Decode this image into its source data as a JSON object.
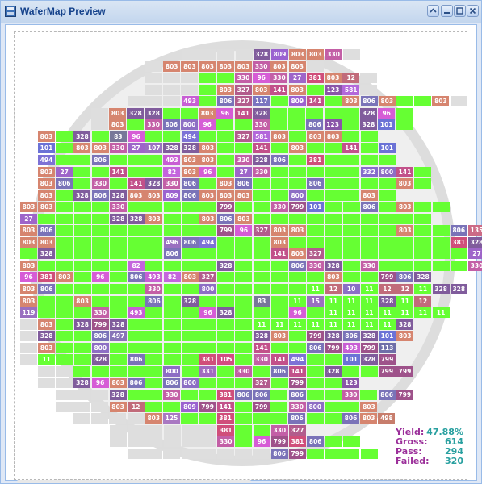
{
  "window": {
    "title": "WaferMap Preview"
  },
  "colors": {
    "pass": "#66ff33",
    "empty": "#dedede",
    "wafer_ring": "#dddddd",
    "wafer_fill": "#eeeeee",
    "bin_colors": {
      "803": "#d6856f",
      "328": "#805c9c",
      "330": "#c35fa6",
      "806": "#7a73b8",
      "141": "#c2518a",
      "96": "#d65cd6",
      "494": "#7d72d6",
      "27": "#9e65c9",
      "799": "#9e528a",
      "101": "#6b72d6",
      "381": "#d04e7a",
      "82": "#c465dd",
      "493": "#c85ed4",
      "581": "#b368db",
      "123": "#8a55a8",
      "809": "#9b62d0",
      "117": "#7a75c0",
      "12": "#c16b7a",
      "83": "#777799",
      "800": "#8d6ec4",
      "807": "#8c71b3",
      "327": "#b25c8c",
      "497": "#8974b8",
      "135": "#cc6b86",
      "498": "#c77d6c",
      "125": "#a978c2",
      "105": "#d24c82",
      "331": "#a16cc0",
      "10": "#8a6fc6",
      "113": "#6f6fa8",
      "332": "#866ccc",
      "11": "#66ff33"
    }
  },
  "wafer": {
    "grid_origin_row": 0,
    "rows": [
      "E:4 D:328 D:809 D:803 D:803 D:330 E:1",
      "E:1 D:803 D:803 D:803 D:803 D:803 D:330 D:803 D:803 E:1",
      "E:3 P:2 D:330 D:96 D:330 D:27 D:381 D:803 D:12 E:1",
      "E:3 P:1 D:803 D:327 D:803 D:141 D:803 P:1 D:123 D:581 E:1",
      "E:3 D:493 P:1 D:806 D:327 D:117 P:1 D:809 D:141 P:1 D:803 D:806 D:803 P:2 D:803 E:1",
      "E:1 D:803 D:328 D:328 P:2 D:803 D:96 D:141 D:328 P:5 D:328 D:96 P:1",
      "E:1 D:803 P:1 D:330 D:806 D:800 D:96 P:2 D:330 P:2 D:806 D:123 P:1 D:328 D:101 P:1",
      "D:803 P:1 D:328 P:1 D:83 D:96 P:2 D:494 P:2 D:327 D:581 D:803 P:1 D:803 D:803 P:2",
      "D:101 P:1 D:803 D:803 D:330 D:27 D:107 D:328 D:328 D:803 P:2 D:141 P:1 D:803 P:2 D:141 P:1 D:101",
      "D:494 P:2 D:806 P:3 D:493 D:803 D:803 P:1 D:330 D:328 D:806 P:1 D:381 P:4",
      "D:803 D:27 P:2 D:141 P:2 D:82 D:803 D:96 P:1 D:27 D:330 P:5 D:332 D:800 D:141 P:1",
      "D:803 D:806 P:1 D:330 P:1 D:141 D:328 D:330 D:806 P:1 D:803 D:806 P:3 D:806 P:4 D:803 P:1",
      "D:803 P:1 D:328 D:806 D:328 D:803 D:803 D:809 D:806 D:803 D:803 D:803 P:2 D:800 P:3 D:803 P:1",
      "D:803 D:803 P:3 D:330 P:5 D:799 P:2 D:330 D:799 D:101 P:2 D:806 P:1 D:803 P:2",
      "D:27 P:4 D:328 D:328 D:803 P:2 D:803 D:806 D:803 P:10",
      "D:803 D:806 P:9 D:799 D:96 D:327 D:803 D:803 P:5 D:803 P:2 D:806 D:135",
      "D:803 D:803 P:6 D:496 D:806 D:494 P:3 D:803 P:9 D:381 D:328",
      "P:1 D:328 P:6 D:806 P:5 D:141 D:803 D:327 P:8 D:27 D:381",
      "D:803 P:5 D:82 P:4 D:328 P:3 D:806 D:330 D:328 P:1 D:330 P:5 D:330",
      "D:96 D:381 D:803 P:1 D:96 P:1 D:806 D:493 D:82 D:803 D:327 P:6 D:803 P:2 D:799 D:806 D:328",
      "D:803 D:806 P:5 D:330 P:2 D:800 P:4 P:1 D:11 D:12 D:10 D:11 D:12 D:12 D:11 D:328 D:328",
      "D:803 P:2 D:803 P:3 D:806 P:1 D:328 P:3 D:83 P:1 D:11 D:15 D:11 D:11 D:11 D:328 D:11 D:12",
      "D:119 P:3 D:330 P:1 D:493 P:3 D:96 D:328 P:3 D:96 P:1 D:11 D:11 D:11 D:11 D:11 D:11 D:11",
      "E:1 D:803 P:1 D:328 D:799 D:328 P:7 D:11 D:11 D:11 D:11 D:11 D:11 D:11 D:11 D:328",
      "E:1 D:328 P:2 D:806 D:497 P:7 D:328 D:803 P:1 D:799 D:328 D:806 D:328 D:101 D:803",
      "E:1 D:803 P:2 D:800 P:8 D:141 P:2 D:806 D:799 D:493 D:799 D:113",
      "E:1 D:11 P:2 D:328 P:1 D:806 P:3 D:381 D:105 P:1 D:330 D:141 D:494 P:2 D:101 D:328 D:799",
      "E:2 P:5 D:800 P:1 D:331 P:1 D:330 P:1 D:806 D:141 P:1 D:328 P:2 D:799 D:799",
      "E:2 D:328 D:96 D:803 D:806 P:1 D:806 D:800 P:3 D:327 P:1 D:799 P:2 D:123",
      "E:3 D:328 P:2 D:330 P:2 D:381 D:806 D:806 P:1 D:806 P:2 D:330 P:1 D:806 D:799",
      "E:3 D:803 D:12 P:2 D:809 D:799 D:141 P:1 D:799 P:1 D:330 D:800 P:2 D:803",
      "E:4 D:803 D:125 P:2 D:381 P:3 D:806 P:2 D:806 D:803 D:498",
      "E:6 D:381 P:2 D:330 D:327",
      "E:6 D:330 P:1 D:96 D:799 D:381 D:806 P:2",
      "E:8 D:806 D:799 P:4"
    ]
  },
  "stats": {
    "yield_label": "Yield:",
    "yield_value": "47.88%",
    "gross_label": "Gross:",
    "gross_value": "614",
    "pass_label": "Pass:",
    "pass_value": "294",
    "failed_label": "Failed:",
    "failed_value": "320"
  }
}
